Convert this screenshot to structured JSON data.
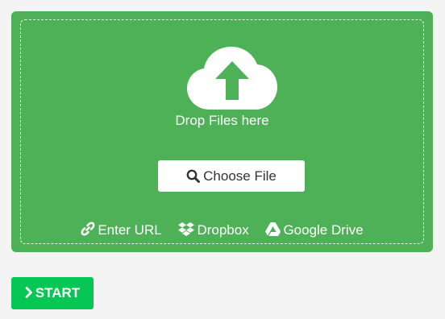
{
  "upload": {
    "drop_text": "Drop Files here",
    "choose_file_label": "Choose File",
    "sources": {
      "url_label": "Enter URL",
      "dropbox_label": "Dropbox",
      "gdrive_label": "Google Drive"
    }
  },
  "actions": {
    "start_label": "START"
  },
  "icons": {
    "upload": "cloud-upload-icon",
    "search": "search-icon",
    "link": "link-icon",
    "dropbox": "dropbox-icon",
    "google_drive": "google-drive-icon",
    "chevron": "chevron-right-icon"
  },
  "colors": {
    "panel_bg": "#4fb157",
    "page_bg": "#f4f4f4",
    "start_button": "#06c754",
    "text_on_panel": "#ffffff"
  }
}
